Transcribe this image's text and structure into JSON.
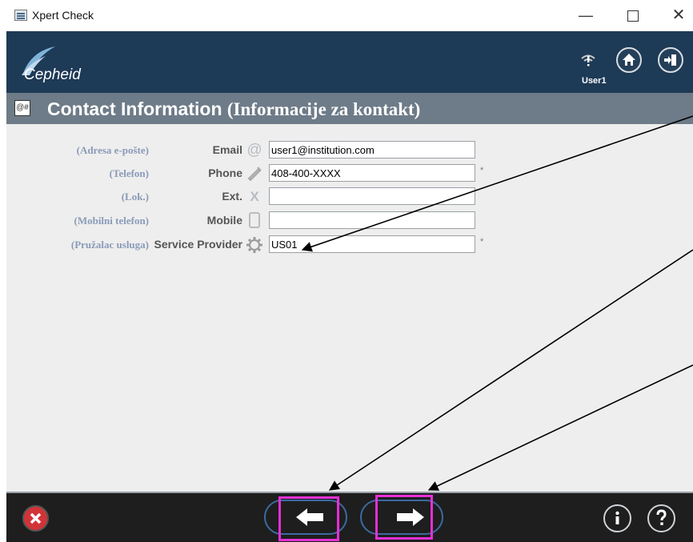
{
  "window": {
    "title": "Xpert Check",
    "minimize_glyph": "—",
    "close_glyph": "✕"
  },
  "header": {
    "logo_text": "Cepheid",
    "user": "User1"
  },
  "page": {
    "title": "Contact Information",
    "title_translation": "(Informacije za kontakt)"
  },
  "fields": [
    {
      "translation": "(Adresa e-pošte)",
      "label": "Email",
      "icon": "at-icon",
      "value": "user1@institution.com",
      "required": false
    },
    {
      "translation": "(Telefon)",
      "label": "Phone",
      "icon": "phone-icon",
      "value": "408-400-XXXX",
      "required": true
    },
    {
      "translation": "(Lok.)",
      "label": "Ext.",
      "icon": "extension-icon",
      "value": "",
      "required": false
    },
    {
      "translation": "(Mobilni telefon)",
      "label": "Mobile",
      "icon": "mobile-icon",
      "value": "",
      "required": false
    },
    {
      "translation": "(Pružalac usluga)",
      "label": "Service Provider",
      "icon": "gear-icon",
      "value": "US01",
      "required": true
    }
  ],
  "required_marker": "*",
  "colors": {
    "header_bg": "#1d3a56",
    "page_bar_bg": "#6e7b88",
    "content_bg": "#eeeeee",
    "footer_bg": "#1e1e1e",
    "cancel_red": "#d13438",
    "highlight_magenta": "#e62fd6",
    "translation_text": "#8a9bb8"
  }
}
